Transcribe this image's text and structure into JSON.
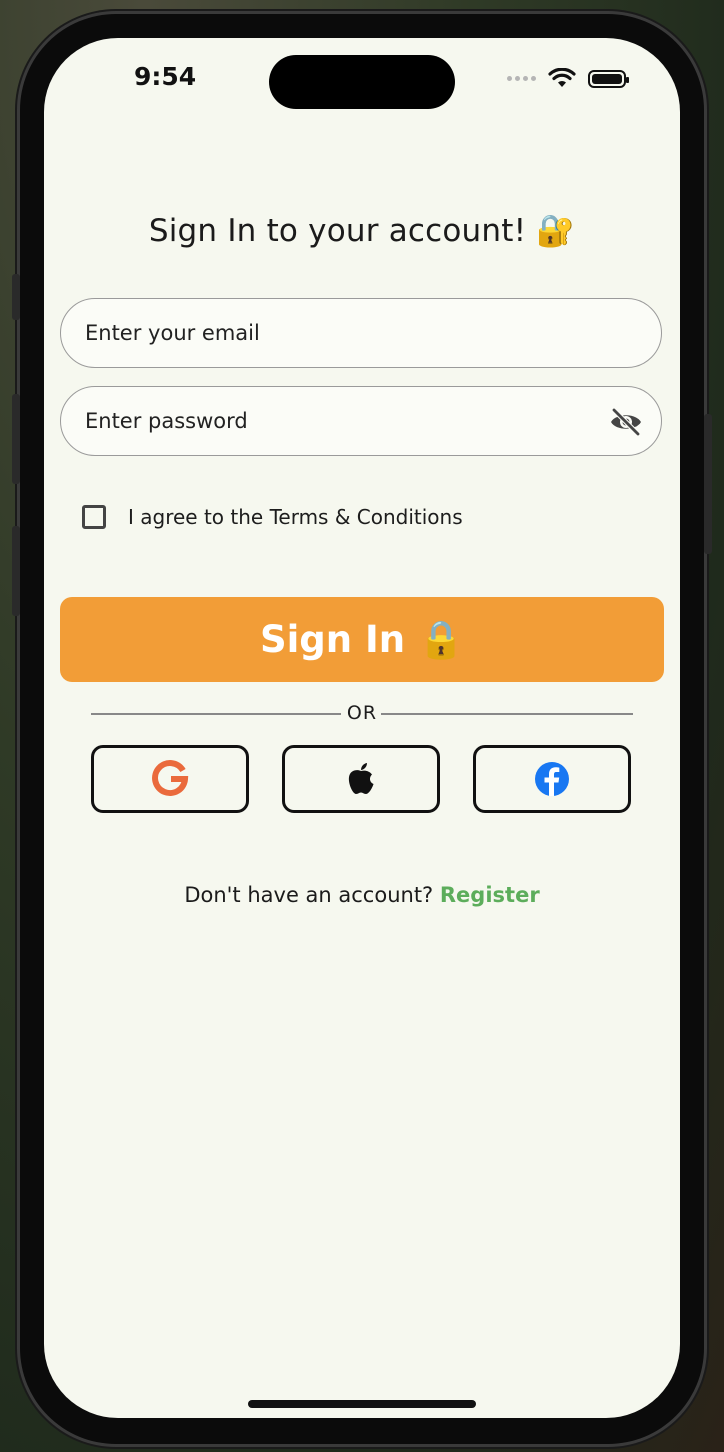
{
  "status_bar": {
    "time": "9:54"
  },
  "header": {
    "title": "Sign In to your account!",
    "title_emoji": "🔐"
  },
  "form": {
    "email_placeholder": "Enter your email",
    "password_placeholder": "Enter password",
    "terms_label": "I agree to the Terms & Conditions",
    "terms_checked": false
  },
  "signin_button": {
    "label": "Sign In",
    "emoji": "🔒"
  },
  "divider": {
    "label": "OR"
  },
  "social_buttons": [
    {
      "icon": "google-icon",
      "color": "#ea6a3c"
    },
    {
      "icon": "apple-icon",
      "color": "#111111"
    },
    {
      "icon": "facebook-icon",
      "color": "#1877f2"
    }
  ],
  "footer": {
    "prompt": "Don't have an account?",
    "register_label": "Register"
  },
  "colors": {
    "background": "#f6f8ef",
    "accent": "#f29d37",
    "link": "#5cad5b"
  }
}
